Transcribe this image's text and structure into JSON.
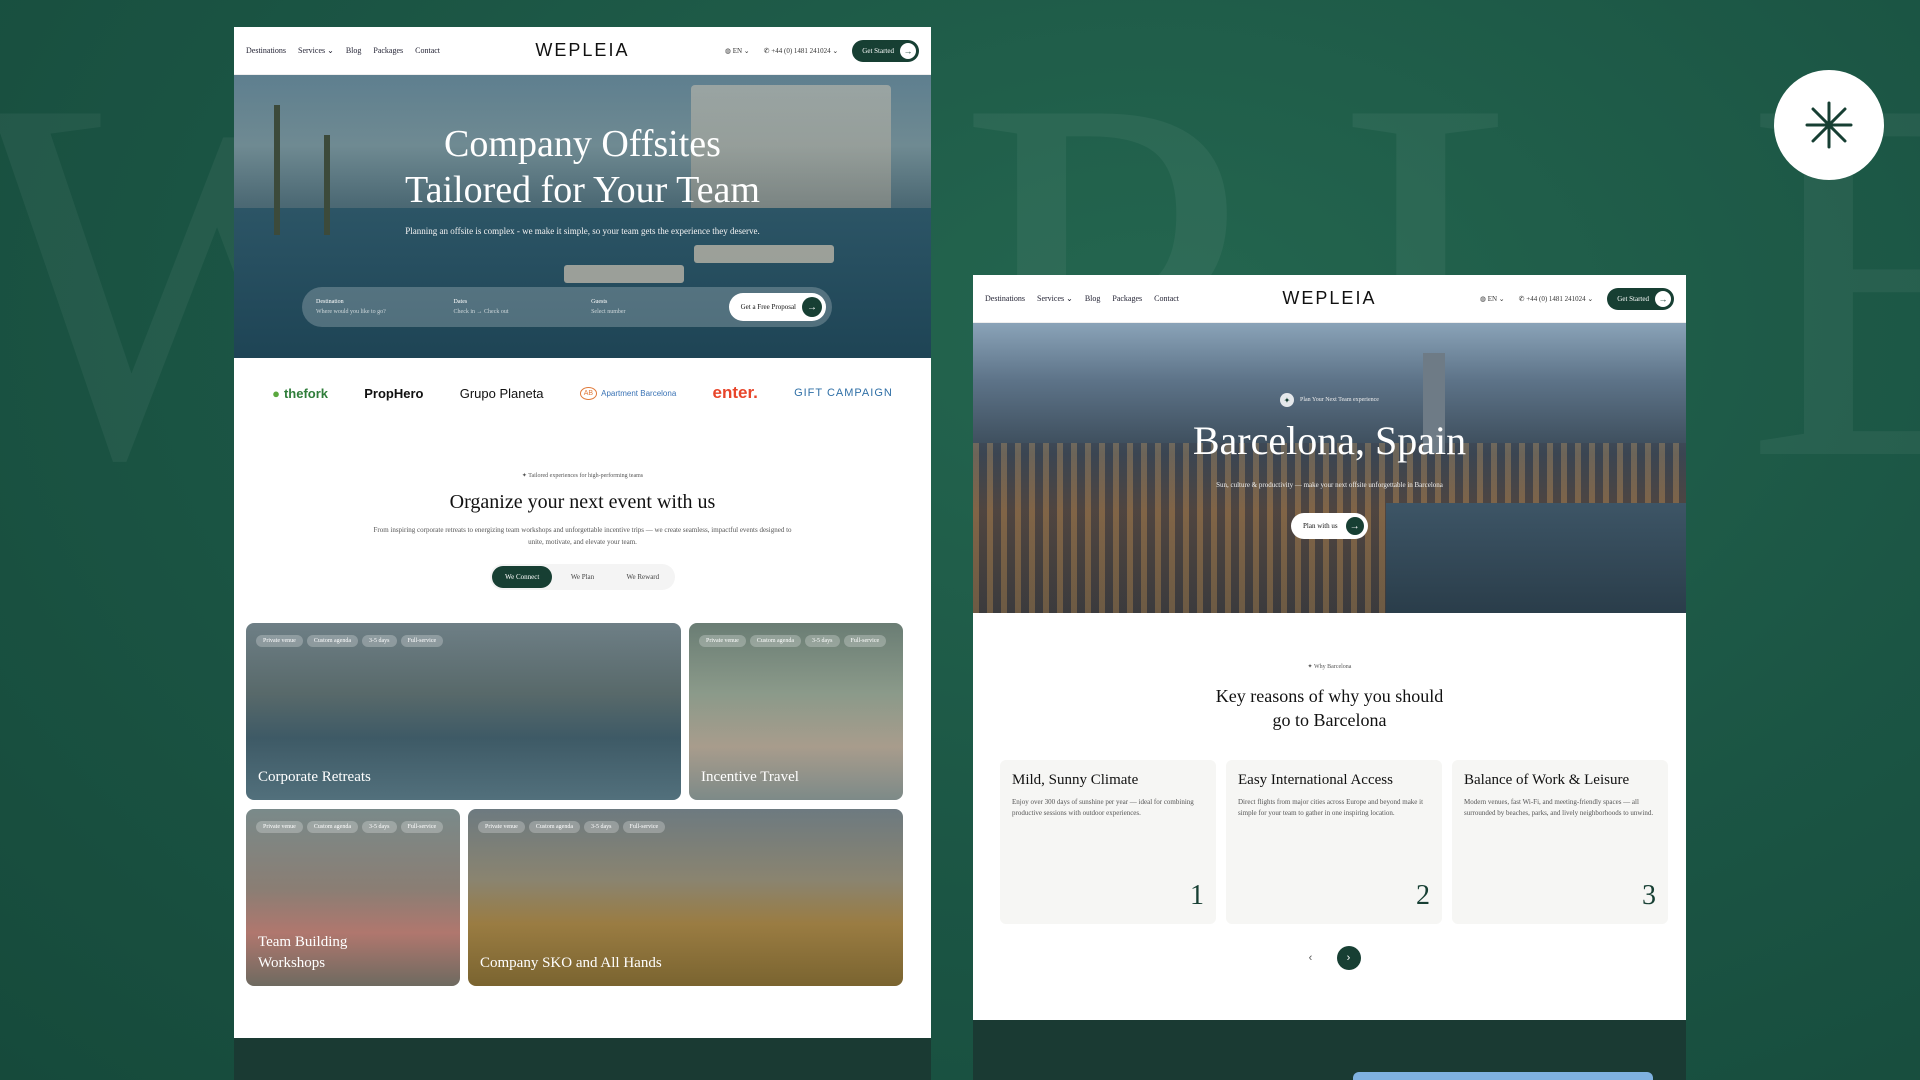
{
  "watermark": "WEPLEIA",
  "nav": {
    "links": [
      "Destinations",
      "Services",
      "Blog",
      "Packages",
      "Contact"
    ],
    "logo": "WEPLEIA",
    "language": "EN",
    "phone": "+44 (0) 1481 241024",
    "cta": "Get Started"
  },
  "left": {
    "hero": {
      "title_line1": "Company Offsites",
      "title_line2": "Tailored for Your Team",
      "subtitle": "Planning an offsite is complex - we make it simple, so your team gets the experience they deserve.",
      "destination_label": "Destination",
      "destination_placeholder": "Where would you like to go?",
      "dates_label": "Dates",
      "dates_placeholder": "Check in → Check out",
      "guests_label": "Guests",
      "guests_placeholder": "Select number",
      "proposal_button": "Get a Free Proposal"
    },
    "logos": [
      "thefork",
      "PropHero",
      "Grupo Planeta",
      "Apartment Barcelona",
      "enter.",
      "GIFT CAMPAIGN"
    ],
    "section": {
      "tag": "Tailored experiences for high-performing teams",
      "title": "Organize your next event with us",
      "description": "From inspiring corporate retreats to energizing team workshops and unforgettable incentive trips — we create seamless, impactful events designed to unite, motivate, and elevate your team.",
      "tabs": [
        "We Connect",
        "We Plan",
        "We Reward"
      ]
    },
    "cards": [
      {
        "label": "Corporate Retreats",
        "tags": [
          "Private venue",
          "Custom agenda",
          "3-5 days",
          "Full-service"
        ]
      },
      {
        "label": "Incentive Travel",
        "tags": [
          "Private venue",
          "Custom agenda",
          "3-5 days",
          "Full-service"
        ]
      },
      {
        "label": "Team Building Workshops",
        "tags": [
          "Private venue",
          "Custom agenda",
          "3-5 days",
          "Full-service"
        ]
      },
      {
        "label": "Company SKO and All Hands",
        "tags": [
          "Private venue",
          "Custom agenda",
          "3-5 days",
          "Full-service"
        ]
      }
    ]
  },
  "right": {
    "hero": {
      "tag": "Plan Your Next Team experience",
      "title": "Barcelona, Spain",
      "subtitle": "Sun, culture & productivity — make your next offsite unforgettable in Barcelona",
      "button": "Plan with us"
    },
    "why": {
      "tag": "Why Barcelona",
      "title": "Key reasons of why you should go to Barcelona",
      "reasons": [
        {
          "title": "Mild, Sunny Climate",
          "text": "Enjoy over 300 days of sunshine per year — ideal for combining productive sessions with outdoor experiences.",
          "num": "1"
        },
        {
          "title": "Easy International Access",
          "text": "Direct flights from major cities across Europe and beyond make it simple for your team to gather in one inspiring location.",
          "num": "2"
        },
        {
          "title": "Balance of Work & Leisure",
          "text": "Modern venues, fast Wi-Fi, and meeting-friendly spaces — all surrounded by beaches, parks, and lively neighborhoods to unwind.",
          "num": "3"
        }
      ]
    }
  },
  "colors": {
    "brand_green": "#173f33",
    "background": "#1d5a47"
  }
}
